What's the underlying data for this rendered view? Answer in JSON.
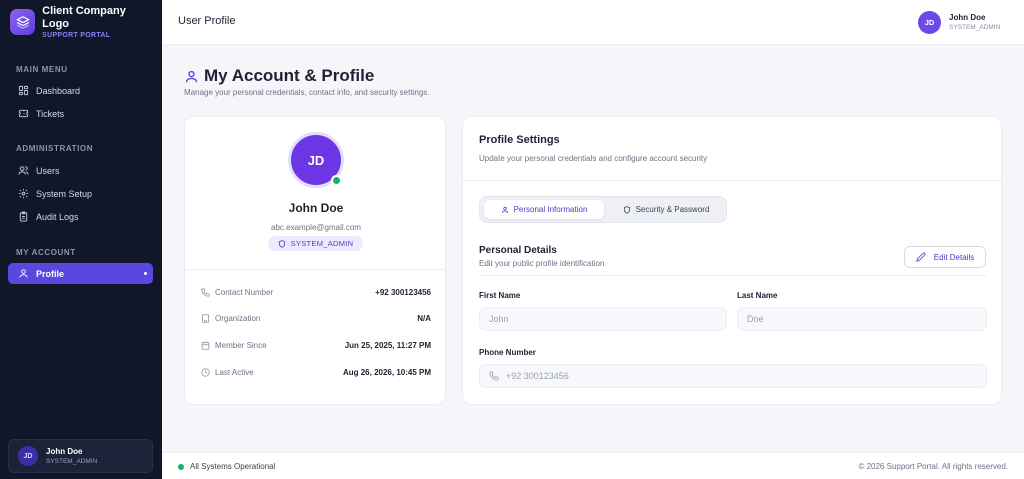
{
  "brand": {
    "title": "Client Company Logo",
    "subtitle": "SUPPORT PORTAL"
  },
  "sidebar": {
    "sections": [
      {
        "title": "MAIN MENU"
      },
      {
        "title": "ADMINISTRATION"
      },
      {
        "title": "MY ACCOUNT"
      }
    ],
    "items": [
      {
        "label": "Dashboard",
        "icon": "dashboard-icon"
      },
      {
        "label": "Tickets",
        "icon": "ticket-icon"
      },
      {
        "label": "Users",
        "icon": "users-icon"
      },
      {
        "label": "System Setup",
        "icon": "gear-icon"
      },
      {
        "label": "Audit Logs",
        "icon": "clipboard-icon"
      },
      {
        "label": "Profile",
        "icon": "user-icon",
        "active": true
      }
    ],
    "user": {
      "initials": "JD",
      "name": "John Doe",
      "role": "SYSTEM_ADMIN"
    }
  },
  "header": {
    "page_name": "User Profile",
    "user": {
      "initials": "JD",
      "name": "John Doe",
      "role": "SYSTEM_ADMIN"
    }
  },
  "page": {
    "title": "My Account & Profile",
    "subtitle": "Manage your personal credentials, contact info, and security settings."
  },
  "profile": {
    "initials": "JD",
    "name": "John Doe",
    "email": "abc.example@gmail.com",
    "role": "SYSTEM_ADMIN",
    "details": [
      {
        "label": "Contact Number",
        "value": "+92 300123456",
        "icon": "phone-icon"
      },
      {
        "label": "Organization",
        "value": "N/A",
        "icon": "building-icon"
      },
      {
        "label": "Member Since",
        "value": "Jun 25, 2025, 11:27 PM",
        "icon": "calendar-icon"
      },
      {
        "label": "Last Active",
        "value": "Aug 26, 2026, 10:45 PM",
        "icon": "clock-icon"
      }
    ]
  },
  "settings": {
    "title": "Profile Settings",
    "subtitle": "Update your personal credentials and configure account security",
    "tabs": [
      {
        "label": "Personal Information",
        "active": true
      },
      {
        "label": "Security & Password",
        "active": false
      }
    ],
    "personal": {
      "title": "Personal Details",
      "subtitle": "Edit your public profile identification",
      "edit_label": "Edit Details",
      "first_name_label": "First Name",
      "first_name_placeholder": "John",
      "last_name_label": "Last Name",
      "last_name_placeholder": "Doe",
      "phone_label": "Phone Number",
      "phone_placeholder": "+92 300123456"
    }
  },
  "footer": {
    "status": "All Systems Operational",
    "copyright": "© 2026 Support Portal. All rights reserved."
  },
  "colors": {
    "accent": "#5b46e0",
    "sidebar_bg": "#0f1729",
    "status_green": "#16b364"
  }
}
